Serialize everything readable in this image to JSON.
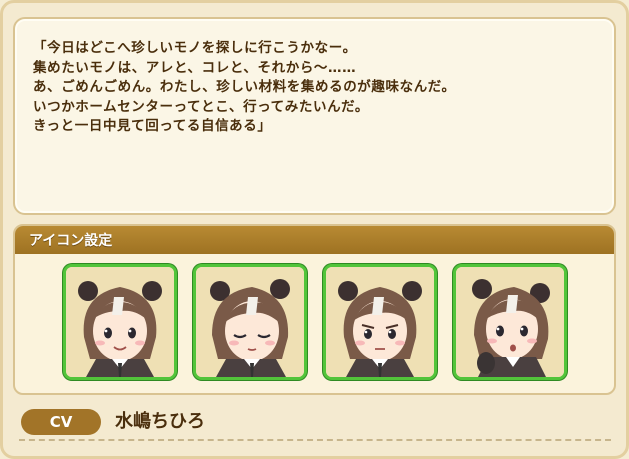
{
  "dialog": {
    "text": "「今日はどこへ珍しいモノを探しに行こうかなー。\n集めたいモノは、アレと、コレと、それから～……\nあ、ごめんごめん。わたし、珍しい材料を集めるのが趣味なんだ。\nいつかホームセンターってとこ、行ってみたいんだ。\nきっと一日中見て回ってる自信ある」"
  },
  "icon_settings": {
    "title": "アイコン設定",
    "icons": [
      {
        "name": "portrait-smile",
        "expression": "smile"
      },
      {
        "name": "portrait-eyes-closed",
        "expression": "eyes-closed"
      },
      {
        "name": "portrait-serious",
        "expression": "serious"
      },
      {
        "name": "portrait-surprised",
        "expression": "surprised"
      }
    ]
  },
  "cv": {
    "badge": "CV",
    "name": "水嶋ちひろ"
  },
  "colors": {
    "accent_brown": "#a27428",
    "selection_green": "#52c43a",
    "text_dark": "#4a2e0c"
  }
}
